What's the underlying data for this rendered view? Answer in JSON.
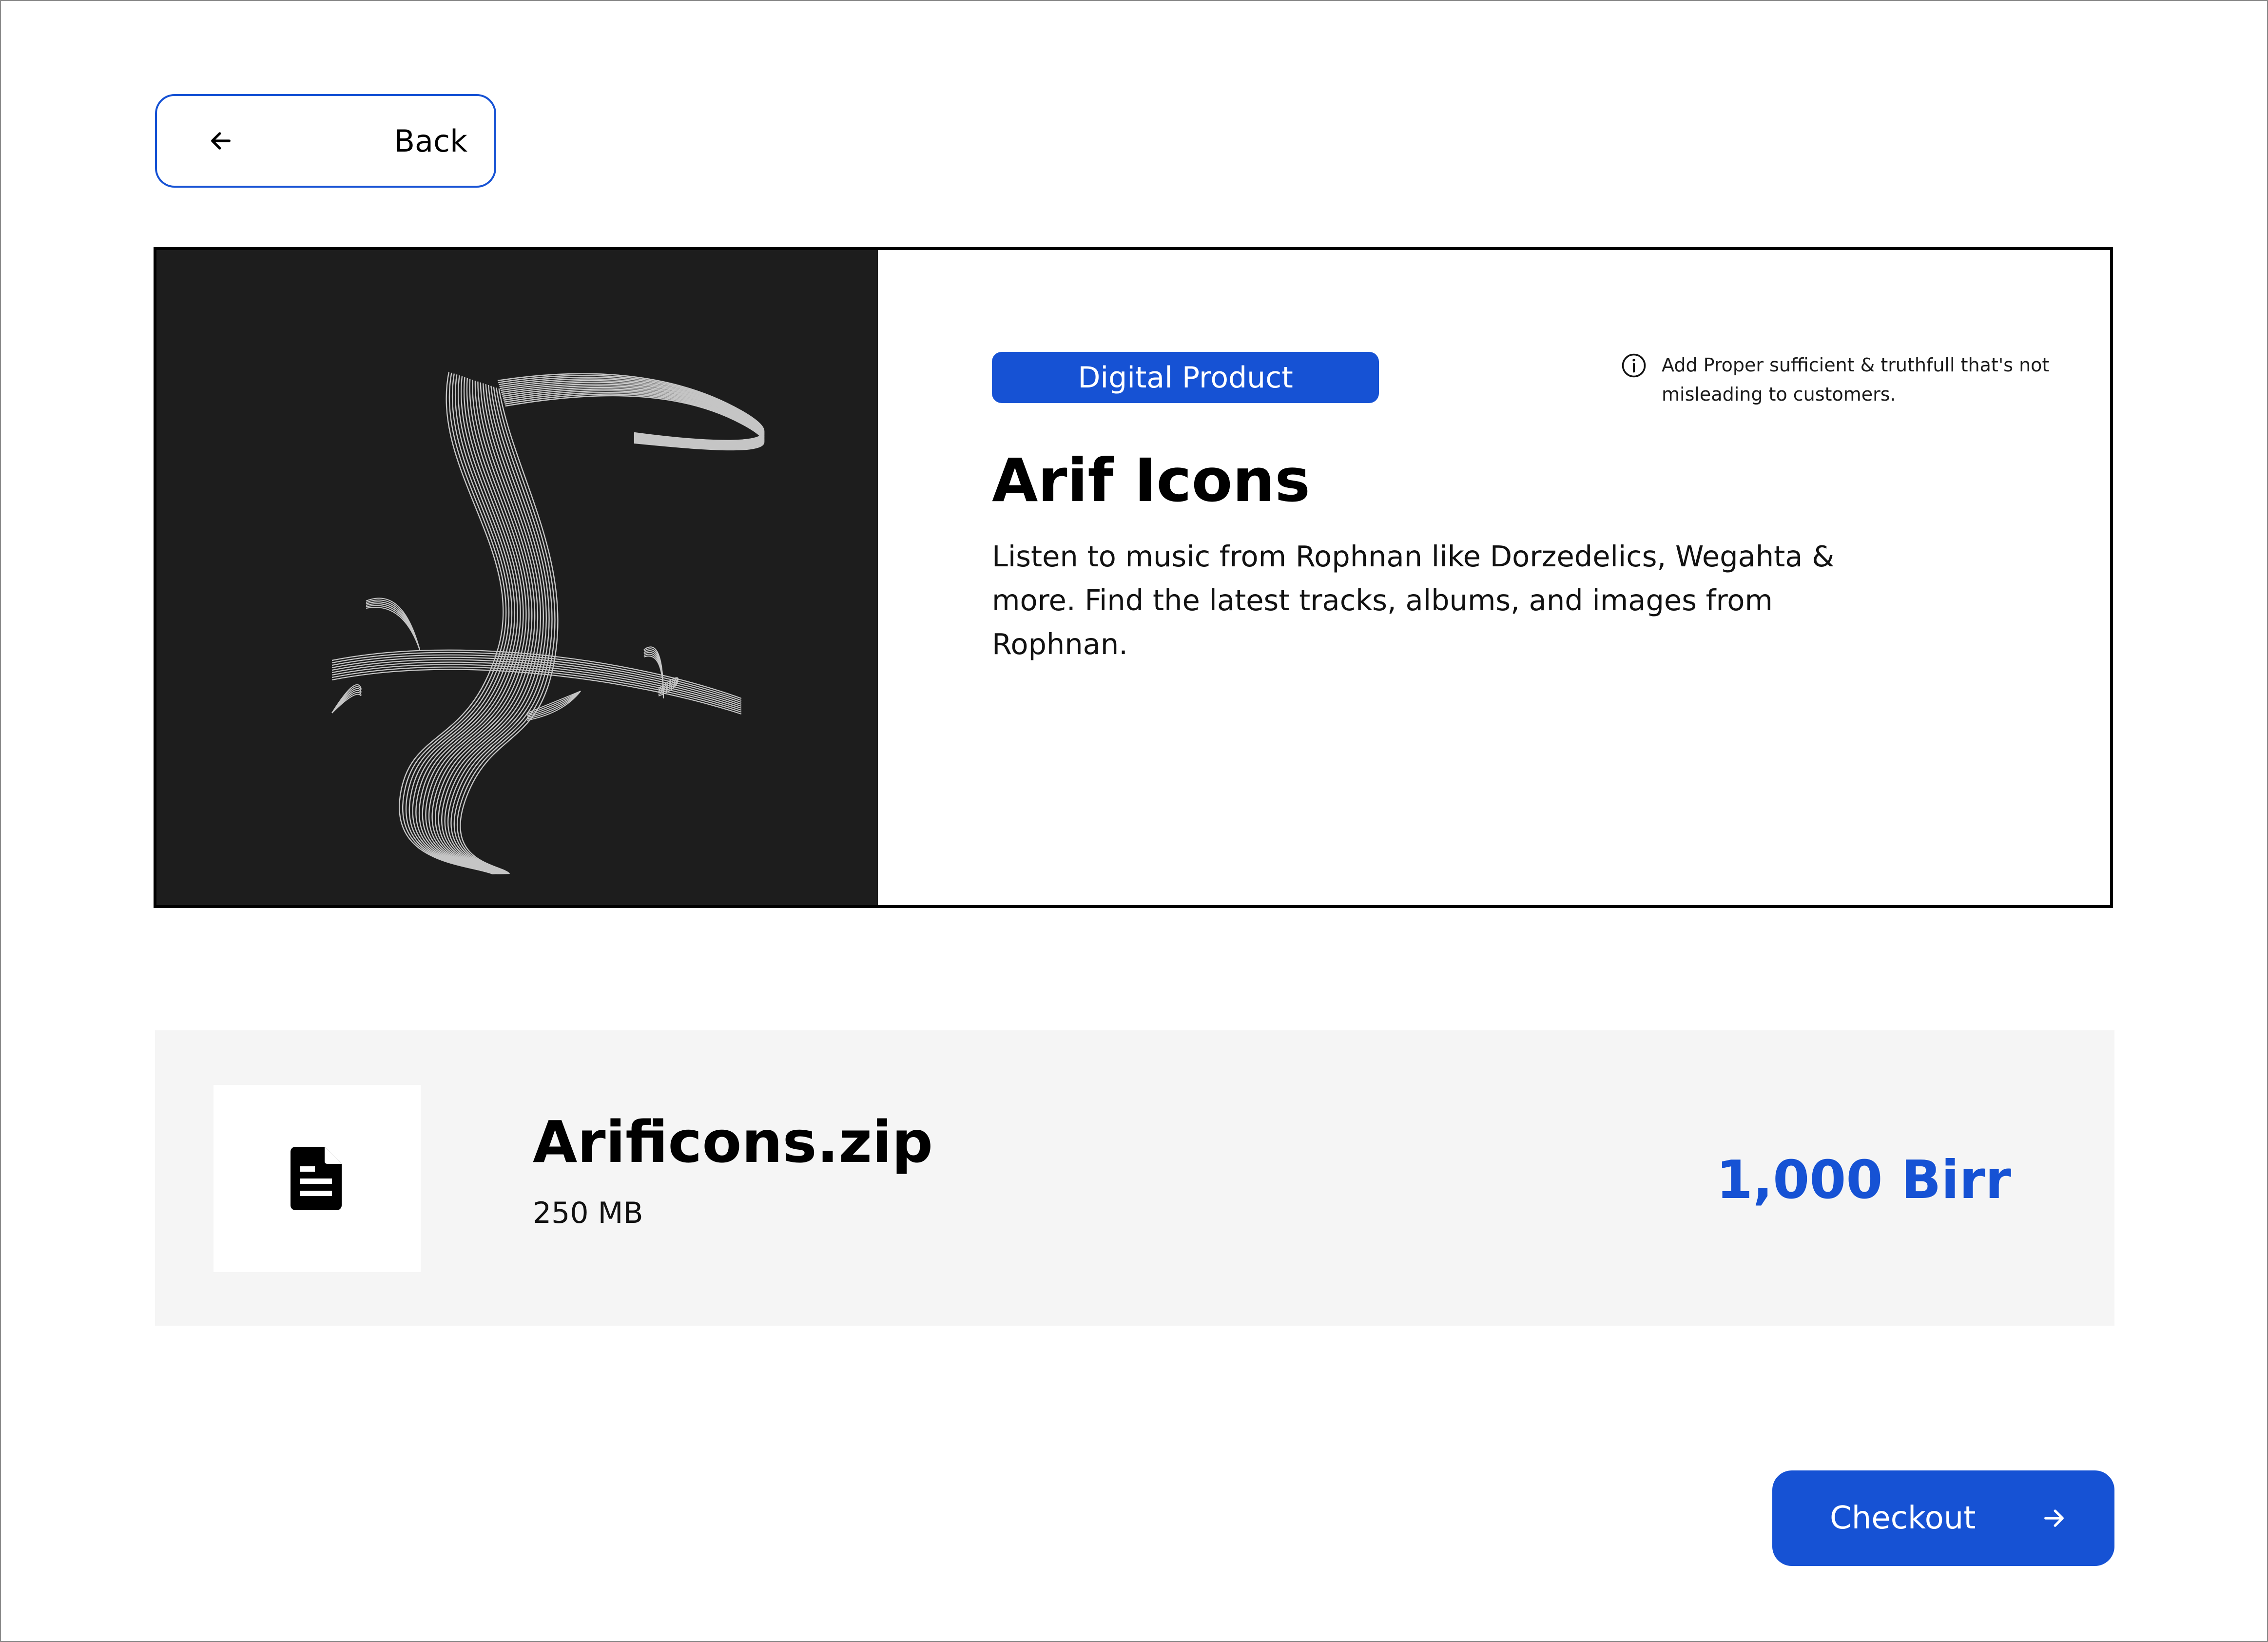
{
  "back": {
    "label": "Back",
    "icon": "arrow-left-icon"
  },
  "product": {
    "badge": "Digital Product",
    "notice": "Add Proper sufficient & truthfull that's not misleading to customers.",
    "notice_icon": "info-icon",
    "title": "Arif Icons",
    "description": "Listen to music from Rophnan like Dorzedelics, Wegahta & more. Find the latest tracks, albums, and images from Rophnan.",
    "image_icon": "toucan-line-art"
  },
  "file": {
    "icon": "document-icon",
    "name": "Arificons.zip",
    "size": "250 MB",
    "price": "1,000 Birr"
  },
  "checkout": {
    "label": "Checkout",
    "icon": "arrow-right-icon"
  },
  "colors": {
    "accent": "#1652d4",
    "art_background": "#1d1d1d",
    "row_background": "#f5f5f5"
  }
}
